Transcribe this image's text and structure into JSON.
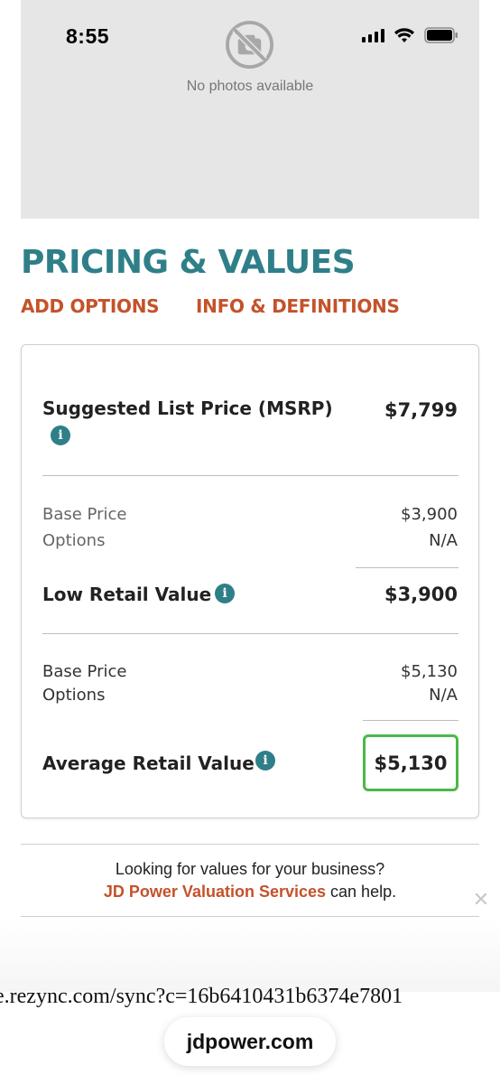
{
  "status_bar": {
    "time": "8:55"
  },
  "photo": {
    "no_photos_text": "No photos available"
  },
  "section": {
    "title": "PRICING & VALUES",
    "links": {
      "add_options": "ADD OPTIONS",
      "info_definitions": "INFO & DEFINITIONS"
    }
  },
  "pricing": {
    "msrp": {
      "label": "Suggested List Price (MSRP)",
      "value": "$7,799"
    },
    "low": {
      "base_label": "Base Price",
      "base_value": "$3,900",
      "options_label": "Options",
      "options_value": "N/A",
      "total_label": "Low Retail Value",
      "total_value": "$3,900"
    },
    "average": {
      "base_label": "Base Price",
      "base_value": "$5,130",
      "options_label": "Options",
      "options_value": "N/A",
      "total_label": "Average Retail Value",
      "total_value": "$5,130"
    }
  },
  "promo": {
    "line1": "Looking for values for your business?",
    "link_text": "JD Power Valuation Services",
    "suffix": " can help."
  },
  "bottom": {
    "sync_url": "e.rezync.com/sync?c=16b6410431b6374e7801",
    "address_bar": "jdpower.com"
  },
  "colors": {
    "accent_teal": "#2f7f89",
    "link_orange": "#c4522a",
    "highlight_green": "#4cb84a"
  },
  "icons": [
    "no-camera-icon",
    "signal-icon",
    "wifi-icon",
    "battery-icon",
    "info-icon",
    "close-icon"
  ]
}
